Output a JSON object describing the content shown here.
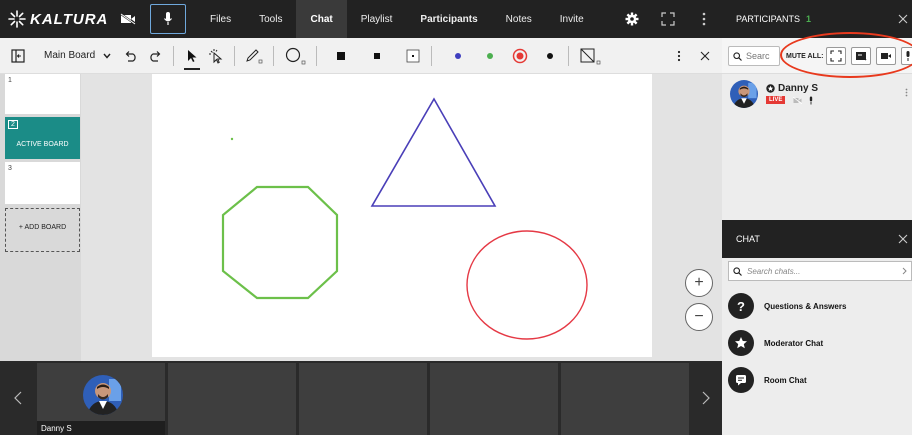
{
  "app": {
    "logo_text": "KALTURA"
  },
  "nav": {
    "items": [
      {
        "label": "Files",
        "active": false,
        "bold": false
      },
      {
        "label": "Tools",
        "active": false,
        "bold": false
      },
      {
        "label": "Chat",
        "active": true,
        "bold": true
      },
      {
        "label": "Playlist",
        "active": false,
        "bold": false
      },
      {
        "label": "Participants",
        "active": false,
        "bold": true
      },
      {
        "label": "Notes",
        "active": false,
        "bold": false
      },
      {
        "label": "Invite",
        "active": false,
        "bold": false
      }
    ]
  },
  "toolbar": {
    "board_select": "Main Board",
    "colors": {
      "blue": "#3f3fbf",
      "green": "#4caf50",
      "red": "#e53935",
      "black": "#111111"
    }
  },
  "boards": {
    "items": [
      {
        "number": "1",
        "label": ""
      },
      {
        "number": "2",
        "label": "ACTIVE BOARD"
      },
      {
        "number": "3",
        "label": ""
      }
    ],
    "add_label": "+ ADD BOARD"
  },
  "canvas": {
    "zoom_in": "+",
    "zoom_out": "−",
    "shape_colors": {
      "triangle": "#4a3fb8",
      "octagon": "#6cc04a",
      "circle": "#e53945",
      "dot": "#6cc04a"
    }
  },
  "strip": {
    "participant_name": "Danny S"
  },
  "participants_panel": {
    "title": "PARTICIPANTS",
    "count": "1",
    "search_placeholder": "Searc",
    "mute_all_label": "MUTE ALL:",
    "participant": {
      "name": "Danny S",
      "status": "LIVE"
    }
  },
  "chat_panel": {
    "title": "CHAT",
    "search_placeholder": "Search chats...",
    "items": [
      {
        "label": "Questions & Answers",
        "icon": "question-icon"
      },
      {
        "label": "Moderator Chat",
        "icon": "star-icon"
      },
      {
        "label": "Room Chat",
        "icon": "message-icon"
      }
    ]
  },
  "accent": {
    "live_red": "#e53935",
    "active_board_teal": "#1b8c87",
    "annotation_red": "#e8391d"
  }
}
